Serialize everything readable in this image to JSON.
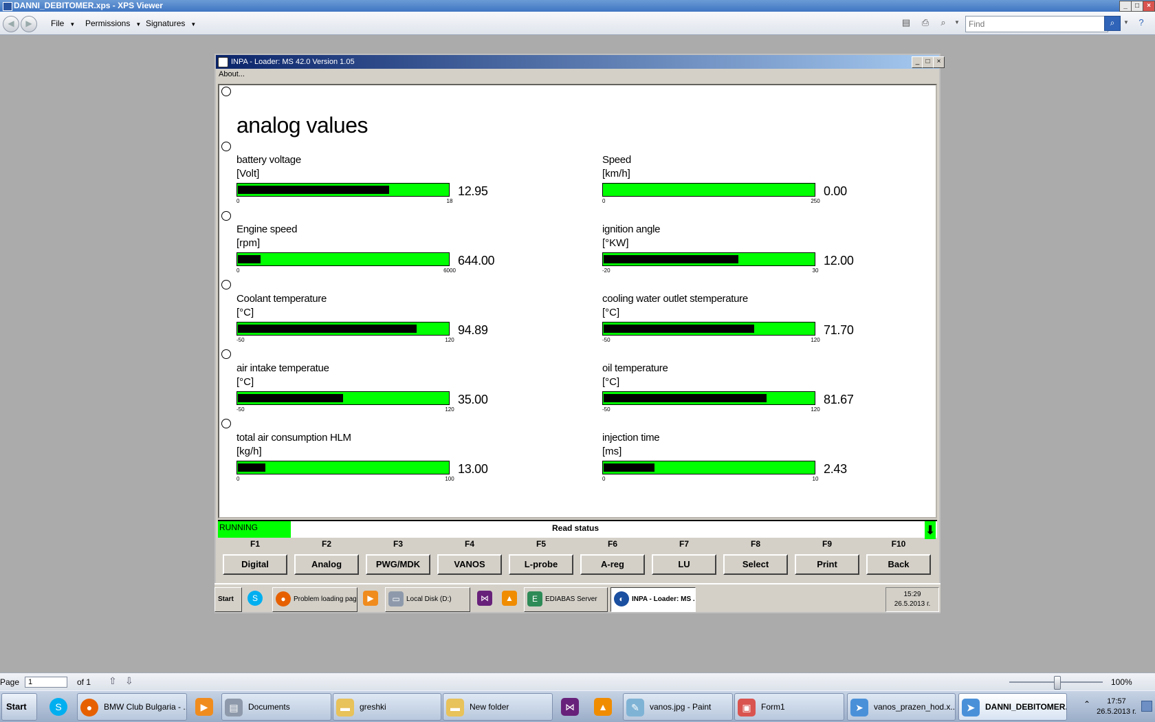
{
  "xps": {
    "title": "DANNI_DEBITOMER.xps - XPS Viewer",
    "menus": [
      "File",
      "Permissions",
      "Signatures"
    ],
    "find_placeholder": "Find",
    "page_label": "Page",
    "page_value": "1",
    "page_of": "of 1",
    "zoom": "100%"
  },
  "inpa": {
    "title": "INPA - Loader:  MS 42.0 Version 1.05",
    "about": "About...",
    "heading": "analog values",
    "gauges": [
      {
        "label": "battery voltage",
        "unit": "[Volt]",
        "value": "12.95",
        "min": "0",
        "max": "18",
        "fill": 0.72
      },
      {
        "label": "Speed",
        "unit": "[km/h]",
        "value": "0.00",
        "min": "0",
        "max": "250",
        "fill": 0.0
      },
      {
        "label": "Engine speed",
        "unit": "[rpm]",
        "value": "644.00",
        "min": "0",
        "max": "6000",
        "fill": 0.107
      },
      {
        "label": "ignition angle",
        "unit": "[°KW]",
        "value": "12.00",
        "min": "-20",
        "max": "30",
        "fill": 0.64
      },
      {
        "label": "Coolant temperature",
        "unit": "[°C]",
        "value": "94.89",
        "min": "-50",
        "max": "120",
        "fill": 0.85
      },
      {
        "label": "cooling water outlet stemperature",
        "unit": "[°C]",
        "value": "71.70",
        "min": "-50",
        "max": "120",
        "fill": 0.716
      },
      {
        "label": "air intake temperatue",
        "unit": "[°C]",
        "value": "35.00",
        "min": "-50",
        "max": "120",
        "fill": 0.5
      },
      {
        "label": "oil temperature",
        "unit": "[°C]",
        "value": "81.67",
        "min": "-50",
        "max": "120",
        "fill": 0.775
      },
      {
        "label": "total air consumption HLM",
        "unit": "[kg/h]",
        "value": "13.00",
        "min": "0",
        "max": "100",
        "fill": 0.13
      },
      {
        "label": "injection time",
        "unit": "[ms]",
        "value": "2.43",
        "min": "0",
        "max": "10",
        "fill": 0.243
      }
    ],
    "status": "RUNNING",
    "read_status": "Read status",
    "fkeys": [
      "F1",
      "F2",
      "F3",
      "F4",
      "F5",
      "F6",
      "F7",
      "F8",
      "F9",
      "F10"
    ],
    "fbuttons": [
      "Digital",
      "Analog",
      "PWG/MDK",
      "VANOS",
      "L-probe",
      "A-reg",
      "LU",
      "Select",
      "Print",
      "Back"
    ]
  },
  "inner_taskbar": {
    "start": "Start",
    "items": [
      "Problem loading page...",
      "Local Disk (D:)",
      "EDIABAS Server",
      "INPA - Loader: MS ..."
    ],
    "time": "15:29",
    "date": "26.5.2013 г."
  },
  "taskbar": {
    "start": "Start",
    "items": [
      "BMW Club Bulgaria - ...",
      "Documents",
      "greshki",
      "New folder",
      "vanos.jpg - Paint",
      "Form1",
      "vanos_prazen_hod.x...",
      "DANNI_DEBITOMER..."
    ],
    "time": "17:57",
    "date": "26.5.2013 г."
  },
  "colors": {
    "bar_green": "#00ff00",
    "title_blue": "#0a246a"
  }
}
